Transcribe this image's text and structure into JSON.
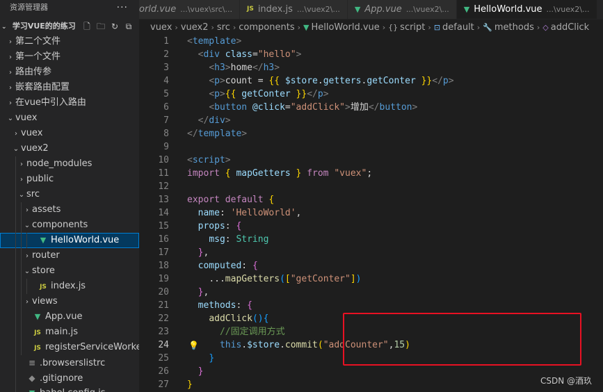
{
  "explorer": {
    "title": "资源管理器",
    "more": "···",
    "section_title": "学习VUE的的练习",
    "tree": [
      {
        "label": "第二个文件",
        "chevron": "›",
        "icon": "",
        "icon_name": "",
        "indent": 0
      },
      {
        "label": "第一个文件",
        "chevron": "›",
        "icon": "",
        "icon_name": "",
        "indent": 0
      },
      {
        "label": "路由传参",
        "chevron": "›",
        "icon": "",
        "icon_name": "",
        "indent": 0
      },
      {
        "label": "嵌套路由配置",
        "chevron": "›",
        "icon": "",
        "icon_name": "",
        "indent": 0
      },
      {
        "label": "在vue中引入路由",
        "chevron": "›",
        "icon": "",
        "icon_name": "",
        "indent": 0
      },
      {
        "label": "vuex",
        "chevron": "⌄",
        "icon": "",
        "icon_name": "",
        "indent": 0
      },
      {
        "label": "vuex",
        "chevron": "›",
        "icon": "",
        "icon_name": "",
        "indent": 1
      },
      {
        "label": "vuex2",
        "chevron": "⌄",
        "icon": "",
        "icon_name": "",
        "indent": 1
      },
      {
        "label": "node_modules",
        "chevron": "›",
        "icon": "",
        "icon_name": "",
        "indent": 2
      },
      {
        "label": "public",
        "chevron": "›",
        "icon": "",
        "icon_name": "",
        "indent": 2
      },
      {
        "label": "src",
        "chevron": "⌄",
        "icon": "",
        "icon_name": "",
        "indent": 2
      },
      {
        "label": "assets",
        "chevron": "›",
        "icon": "",
        "icon_name": "",
        "indent": 3
      },
      {
        "label": "components",
        "chevron": "⌄",
        "icon": "",
        "icon_name": "",
        "indent": 3
      },
      {
        "label": "HelloWorld.vue",
        "chevron": "",
        "icon": "▼",
        "icon_name": "vue",
        "indent": 4,
        "selected": true
      },
      {
        "label": "router",
        "chevron": "›",
        "icon": "",
        "icon_name": "",
        "indent": 3
      },
      {
        "label": "store",
        "chevron": "⌄",
        "icon": "",
        "icon_name": "",
        "indent": 3
      },
      {
        "label": "index.js",
        "chevron": "",
        "icon": "JS",
        "icon_name": "js",
        "indent": 4
      },
      {
        "label": "views",
        "chevron": "›",
        "icon": "",
        "icon_name": "",
        "indent": 3
      },
      {
        "label": "App.vue",
        "chevron": "",
        "icon": "▼",
        "icon_name": "vue",
        "indent": 3
      },
      {
        "label": "main.js",
        "chevron": "",
        "icon": "JS",
        "icon_name": "js",
        "indent": 3
      },
      {
        "label": "registerServiceWorker.js",
        "chevron": "",
        "icon": "JS",
        "icon_name": "js",
        "indent": 3
      },
      {
        "label": ".browserslistrc",
        "chevron": "",
        "icon": "≡",
        "icon_name": "config",
        "indent": 2
      },
      {
        "label": ".gitignore",
        "chevron": "",
        "icon": "◆",
        "icon_name": "git",
        "indent": 2
      },
      {
        "label": "babel.config.js",
        "chevron": "",
        "icon": "▼",
        "icon_name": "babel",
        "indent": 2
      }
    ]
  },
  "tabs": [
    {
      "name": "orld.vue",
      "desc": "...\\vuex\\src\\...",
      "icon": "",
      "icon_name": "",
      "active": false,
      "italic": true
    },
    {
      "name": "index.js",
      "desc": "...\\vuex2\\...",
      "icon": "JS",
      "icon_name": "js",
      "active": false,
      "italic": false
    },
    {
      "name": "App.vue",
      "desc": "...\\vuex2\\...",
      "icon": "▼",
      "icon_name": "vue",
      "active": false,
      "italic": true
    },
    {
      "name": "HelloWorld.vue",
      "desc": "...\\vuex2\\...",
      "icon": "▼",
      "icon_name": "vue",
      "active": true,
      "italic": false
    }
  ],
  "breadcrumb": [
    "vuex",
    "vuex2",
    "src",
    "components",
    "HelloWorld.vue",
    "script",
    "default",
    "methods",
    "addClick"
  ],
  "breadcrumb_icons": {
    "file": "▼",
    "script": "{}",
    "default": "⊡",
    "methods": "🔧",
    "addClick": "◇"
  },
  "code": {
    "current_line": 24,
    "lines": [
      [
        {
          "t": "<",
          "c": "brk"
        },
        {
          "t": "template",
          "c": "tag"
        },
        {
          "t": ">",
          "c": "brk"
        }
      ],
      [
        {
          "t": "  "
        },
        {
          "t": "<",
          "c": "brk"
        },
        {
          "t": "div",
          "c": "tag"
        },
        {
          "t": " class",
          "c": "attr"
        },
        {
          "t": "=",
          "c": "plain"
        },
        {
          "t": "\"hello\"",
          "c": "str"
        },
        {
          "t": ">",
          "c": "brk"
        }
      ],
      [
        {
          "t": "    "
        },
        {
          "t": "<",
          "c": "brk"
        },
        {
          "t": "h3",
          "c": "tag"
        },
        {
          "t": ">",
          "c": "brk"
        },
        {
          "t": "home",
          "c": "plain"
        },
        {
          "t": "</",
          "c": "brk"
        },
        {
          "t": "h3",
          "c": "tag"
        },
        {
          "t": ">",
          "c": "brk"
        }
      ],
      [
        {
          "t": "    "
        },
        {
          "t": "<",
          "c": "brk"
        },
        {
          "t": "p",
          "c": "tag"
        },
        {
          "t": ">",
          "c": "brk"
        },
        {
          "t": "count = ",
          "c": "plain"
        },
        {
          "t": "{{",
          "c": "b1"
        },
        {
          "t": " $store",
          "c": "prop"
        },
        {
          "t": ".",
          "c": "plain"
        },
        {
          "t": "getters",
          "c": "prop"
        },
        {
          "t": ".",
          "c": "plain"
        },
        {
          "t": "getConter",
          "c": "prop"
        },
        {
          "t": " }}",
          "c": "b1"
        },
        {
          "t": "</",
          "c": "brk"
        },
        {
          "t": "p",
          "c": "tag"
        },
        {
          "t": ">",
          "c": "brk"
        }
      ],
      [
        {
          "t": "    "
        },
        {
          "t": "<",
          "c": "brk"
        },
        {
          "t": "p",
          "c": "tag"
        },
        {
          "t": ">",
          "c": "brk"
        },
        {
          "t": "{{",
          "c": "b1"
        },
        {
          "t": " getConter",
          "c": "prop"
        },
        {
          "t": " }}",
          "c": "b1"
        },
        {
          "t": "</",
          "c": "brk"
        },
        {
          "t": "p",
          "c": "tag"
        },
        {
          "t": ">",
          "c": "brk"
        }
      ],
      [
        {
          "t": "    "
        },
        {
          "t": "<",
          "c": "brk"
        },
        {
          "t": "button",
          "c": "tag"
        },
        {
          "t": " @click",
          "c": "attr"
        },
        {
          "t": "=",
          "c": "plain"
        },
        {
          "t": "\"addClick\"",
          "c": "str"
        },
        {
          "t": ">",
          "c": "brk"
        },
        {
          "t": "增加",
          "c": "plain"
        },
        {
          "t": "</",
          "c": "brk"
        },
        {
          "t": "button",
          "c": "tag"
        },
        {
          "t": ">",
          "c": "brk"
        }
      ],
      [
        {
          "t": "  "
        },
        {
          "t": "</",
          "c": "brk"
        },
        {
          "t": "div",
          "c": "tag"
        },
        {
          "t": ">",
          "c": "brk"
        }
      ],
      [
        {
          "t": "</",
          "c": "brk"
        },
        {
          "t": "template",
          "c": "tag"
        },
        {
          "t": ">",
          "c": "brk"
        }
      ],
      [],
      [
        {
          "t": "<",
          "c": "brk"
        },
        {
          "t": "script",
          "c": "tag"
        },
        {
          "t": ">",
          "c": "brk"
        }
      ],
      [
        {
          "t": "import",
          "c": "kw"
        },
        {
          "t": " "
        },
        {
          "t": "{",
          "c": "b1"
        },
        {
          "t": " mapGetters ",
          "c": "prop"
        },
        {
          "t": "}",
          "c": "b1"
        },
        {
          "t": " from",
          "c": "kw"
        },
        {
          "t": " "
        },
        {
          "t": "\"vuex\"",
          "c": "str"
        },
        {
          "t": ";",
          "c": "plain"
        }
      ],
      [],
      [
        {
          "t": "export",
          "c": "kw"
        },
        {
          "t": " default",
          "c": "kw"
        },
        {
          "t": " "
        },
        {
          "t": "{",
          "c": "b1"
        }
      ],
      [
        {
          "t": "  "
        },
        {
          "t": "name",
          "c": "prop"
        },
        {
          "t": ": ",
          "c": "plain"
        },
        {
          "t": "'HelloWorld'",
          "c": "str"
        },
        {
          "t": ",",
          "c": "plain"
        }
      ],
      [
        {
          "t": "  "
        },
        {
          "t": "props",
          "c": "prop"
        },
        {
          "t": ": ",
          "c": "plain"
        },
        {
          "t": "{",
          "c": "b2"
        }
      ],
      [
        {
          "t": "    "
        },
        {
          "t": "msg",
          "c": "prop"
        },
        {
          "t": ": ",
          "c": "plain"
        },
        {
          "t": "String",
          "c": "typ"
        }
      ],
      [
        {
          "t": "  "
        },
        {
          "t": "}",
          "c": "b2"
        },
        {
          "t": ",",
          "c": "plain"
        }
      ],
      [
        {
          "t": "  "
        },
        {
          "t": "computed",
          "c": "prop"
        },
        {
          "t": ": ",
          "c": "plain"
        },
        {
          "t": "{",
          "c": "b2"
        }
      ],
      [
        {
          "t": "    "
        },
        {
          "t": "...",
          "c": "plain"
        },
        {
          "t": "mapGetters",
          "c": "fn"
        },
        {
          "t": "(",
          "c": "b3"
        },
        {
          "t": "[",
          "c": "b1"
        },
        {
          "t": "\"getConter\"",
          "c": "str"
        },
        {
          "t": "]",
          "c": "b1"
        },
        {
          "t": ")",
          "c": "b3"
        }
      ],
      [
        {
          "t": "  "
        },
        {
          "t": "}",
          "c": "b2"
        },
        {
          "t": ",",
          "c": "plain"
        }
      ],
      [
        {
          "t": "  "
        },
        {
          "t": "methods",
          "c": "prop"
        },
        {
          "t": ": ",
          "c": "plain"
        },
        {
          "t": "{",
          "c": "b2"
        }
      ],
      [
        {
          "t": "    "
        },
        {
          "t": "addClick",
          "c": "fn"
        },
        {
          "t": "(",
          "c": "b3"
        },
        {
          "t": ")",
          "c": "b3"
        },
        {
          "t": "{",
          "c": "b3"
        }
      ],
      [
        {
          "t": "      "
        },
        {
          "t": "//固定调用方式",
          "c": "com"
        }
      ],
      [
        {
          "t": "      "
        },
        {
          "t": "this",
          "c": "kw2"
        },
        {
          "t": ".",
          "c": "plain"
        },
        {
          "t": "$store",
          "c": "prop"
        },
        {
          "t": ".",
          "c": "plain"
        },
        {
          "t": "commit",
          "c": "fn"
        },
        {
          "t": "(",
          "c": "b1"
        },
        {
          "t": "\"addCounter\"",
          "c": "str"
        },
        {
          "t": ",",
          "c": "plain"
        },
        {
          "t": "15",
          "c": "num"
        },
        {
          "t": ")",
          "c": "b1"
        }
      ],
      [
        {
          "t": "    "
        },
        {
          "t": "}",
          "c": "b3"
        }
      ],
      [
        {
          "t": "  "
        },
        {
          "t": "}",
          "c": "b2"
        }
      ],
      [
        {
          "t": "}",
          "c": "b1"
        }
      ]
    ]
  },
  "watermark": "CSDN @酒玖",
  "colors": {
    "highlight_box": "#e81123",
    "vue_icon": "#41b883",
    "js_icon": "#cbcb41"
  }
}
